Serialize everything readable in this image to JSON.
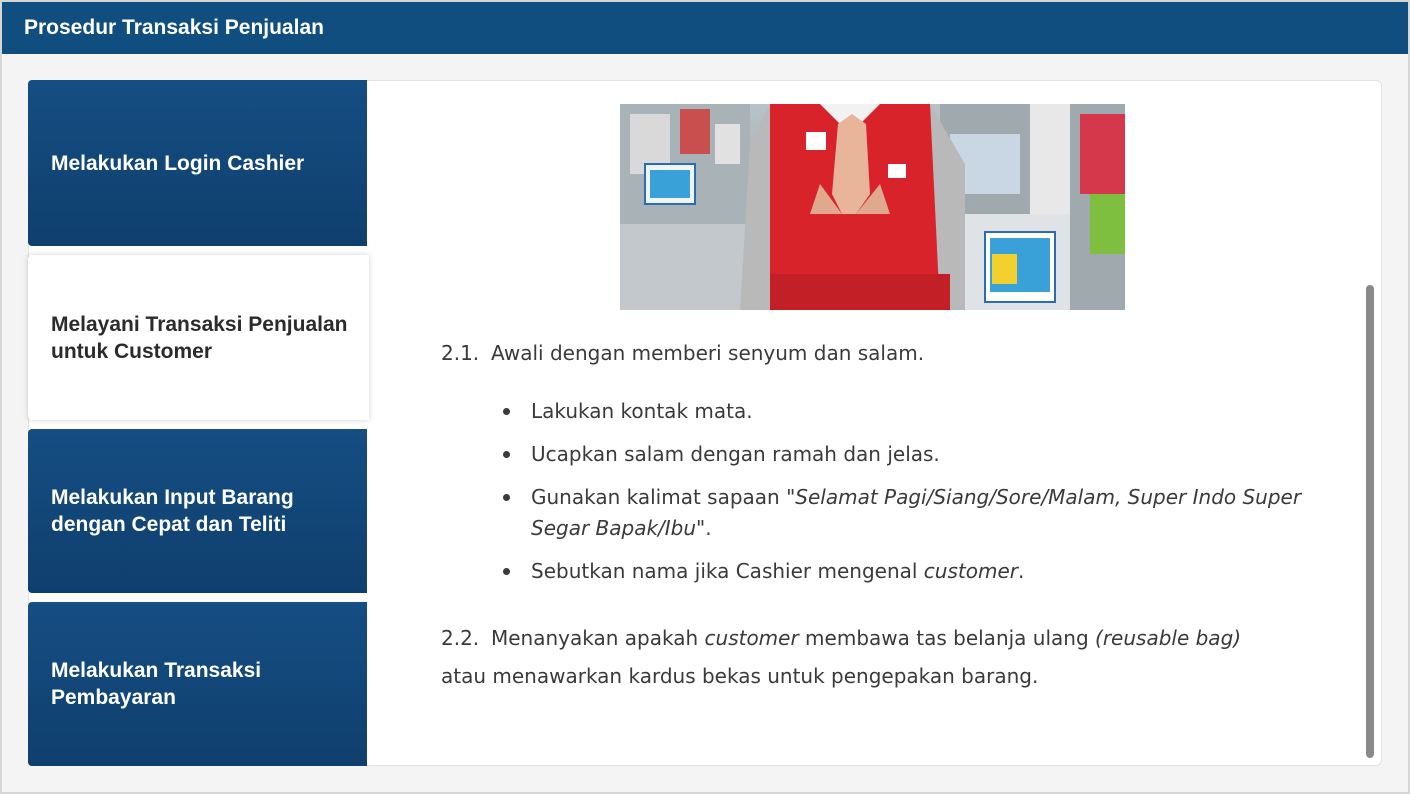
{
  "header": {
    "title": "Prosedur Transaksi Penjualan"
  },
  "tabs": [
    {
      "label": "Melakukan Login Cashier",
      "active": false
    },
    {
      "label": "Melayani Transaksi Penjualan untuk Customer",
      "active": true
    },
    {
      "label": "Melakukan Input Barang dengan Cepat dan Teliti",
      "active": false
    },
    {
      "label": "Melakukan Transaksi Pembayaran",
      "active": false
    }
  ],
  "content": {
    "step1": {
      "number": "2.1.",
      "text": "Awali dengan memberi senyum dan salam."
    },
    "bullets": [
      {
        "text": "Lakukan kontak mata."
      },
      {
        "text": "Ucapkan salam dengan ramah dan jelas."
      },
      {
        "text": "Gunakan kalimat sapaan ",
        "italic": "\"Selamat Pagi/Siang/Sore/Malam, Super Indo Super Segar Bapak/Ibu\"",
        "after": "."
      },
      {
        "text": "Sebutkan nama jika Cashier mengenal ",
        "italic": "customer",
        "after": "."
      }
    ],
    "step2": {
      "number": "2.2.",
      "part1": "Menanyakan apakah ",
      "italic1": "customer",
      "part2": " membawa tas belanja ulang ",
      "italic2": "(reusable bag)",
      "part3": "atau menawarkan kardus bekas untuk pengepakan barang."
    }
  },
  "colors": {
    "header_bg": "#114e80",
    "tab_bg": "#134a7c",
    "text": "#3a3a3a"
  }
}
